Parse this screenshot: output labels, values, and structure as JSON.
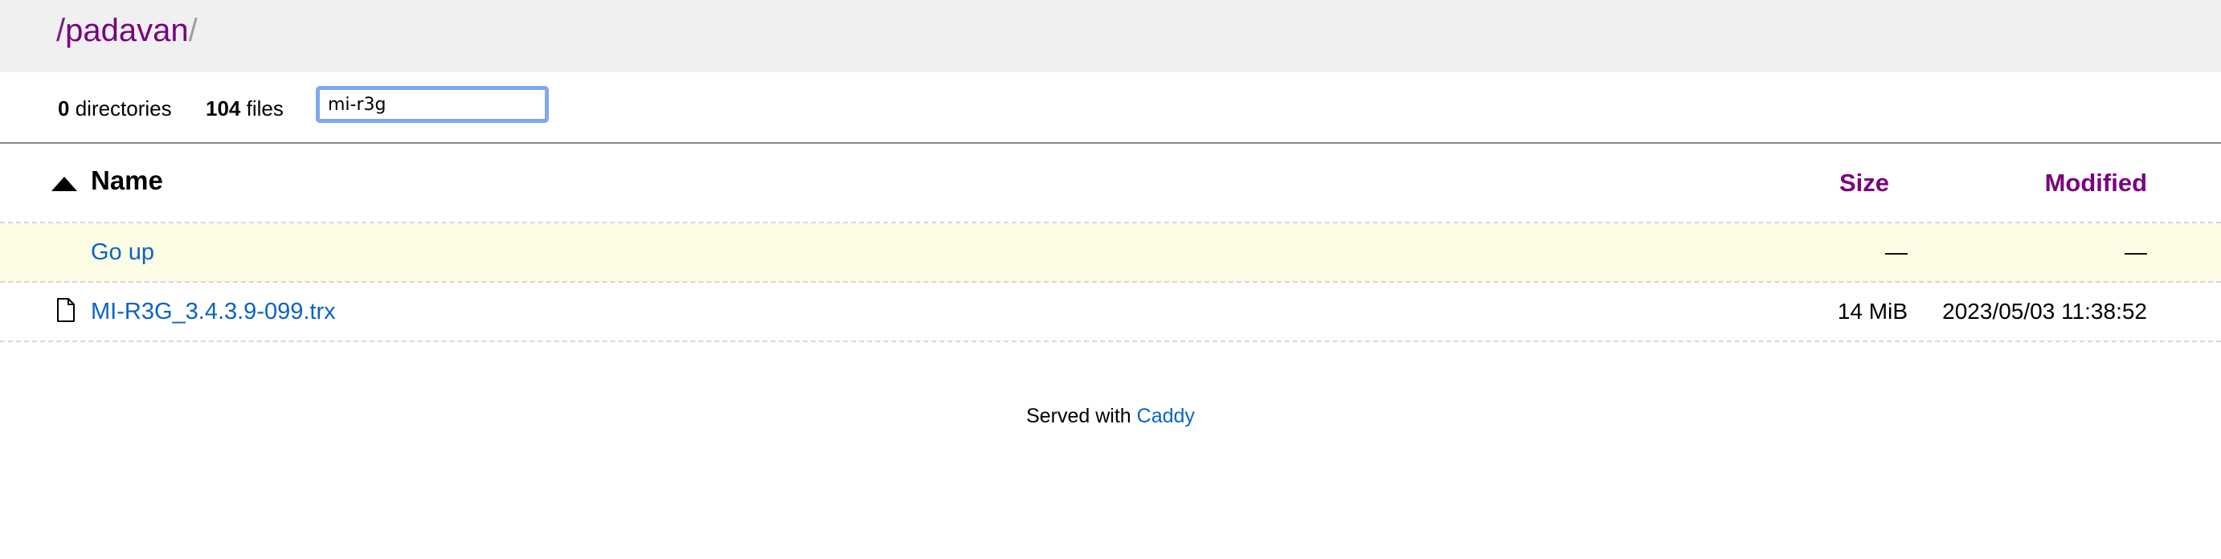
{
  "breadcrumb": {
    "root_sep": "/",
    "folder": "padavan",
    "trailing_sep": "/"
  },
  "summary": {
    "dir_count": "0",
    "dir_label": "directories",
    "file_count": "104",
    "file_label": "files",
    "filter_value": "mi-r3g"
  },
  "table": {
    "headers": {
      "name": "Name",
      "size": "Size",
      "modified": "Modified"
    },
    "sort_icon": "sort-ascending-icon",
    "rows": [
      {
        "name": "Go up",
        "size": "—",
        "modified": "—",
        "icon": ""
      },
      {
        "name": "MI-R3G_3.4.3.9-099.trx",
        "size": "14 MiB",
        "modified": "2023/05/03 11:38:52",
        "icon": "file-icon"
      }
    ]
  },
  "footer": {
    "text": "Served with",
    "link": "Caddy"
  },
  "colors": {
    "link": "#0a63c8",
    "header_link": "#7a007f",
    "header_bg": "#f0f0f0",
    "goup_row_bg": "#fdfde6",
    "input_focus": "#7ea9ef"
  }
}
